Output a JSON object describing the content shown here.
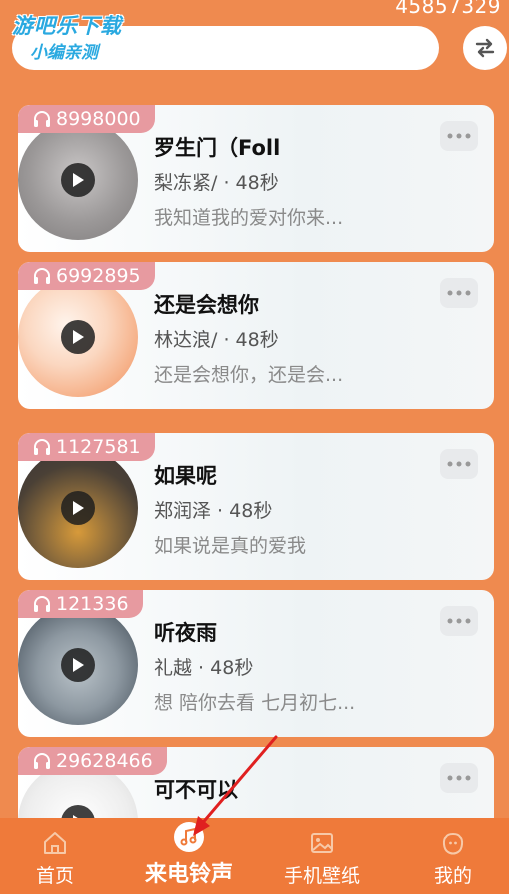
{
  "header": {
    "top_number": "45857329",
    "watermark_line1": "游吧乐下载",
    "watermark_line2": "小编亲测"
  },
  "songs": [
    {
      "plays": "8998000",
      "title": "罗生门（Foll",
      "artist": "梨冻紧/",
      "duration": "48秒",
      "lyric": "我知道我的爱对你来..."
    },
    {
      "plays": "6992895",
      "title": "还是会想你",
      "artist": "林达浪/",
      "duration": "48秒",
      "lyric": "还是会想你，还是会..."
    },
    {
      "plays": "1127581",
      "title": "如果呢",
      "artist": "郑润泽",
      "duration": "48秒",
      "lyric": "如果说是真的爱我"
    },
    {
      "plays": "121336",
      "title": "听夜雨",
      "artist": "礼越",
      "duration": "48秒",
      "lyric": "想 陪你去看 七月初七..."
    },
    {
      "plays": "29628466",
      "title": "可不可以",
      "artist": "",
      "duration": "",
      "lyric": ""
    }
  ],
  "separator": " · ",
  "tabs": [
    {
      "label": "首页",
      "icon": "home-icon"
    },
    {
      "label": "来电铃声",
      "icon": "music-note-icon"
    },
    {
      "label": "手机壁纸",
      "icon": "image-icon"
    },
    {
      "label": "我的",
      "icon": "profile-icon"
    }
  ],
  "colors": {
    "background": "#ef8a4f",
    "tabbar": "#ef7a3a",
    "play_badge": "#e79aa0",
    "annotation_arrow": "#e02020"
  }
}
